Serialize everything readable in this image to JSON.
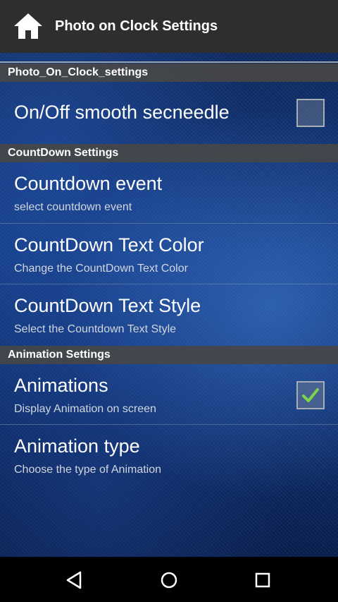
{
  "action_bar": {
    "icon": "home-icon",
    "title": "Photo on Clock Settings"
  },
  "sections": [
    {
      "header": "Photo_On_Clock_settings",
      "items": [
        {
          "title": "On/Off smooth secneedle",
          "summary": "",
          "checkbox": true,
          "checked": false
        }
      ]
    },
    {
      "header": "CountDown Settings",
      "items": [
        {
          "title": "Countdown event",
          "summary": "select countdown event"
        },
        {
          "title": "CountDown Text Color",
          "summary": "Change the CountDown Text Color"
        },
        {
          "title": "CountDown Text Style",
          "summary": "Select the Countdown Text Style"
        }
      ]
    },
    {
      "header": "Animation Settings",
      "items": [
        {
          "title": "Animations",
          "summary": "Display Animation on screen",
          "checkbox": true,
          "checked": true
        },
        {
          "title": "Animation type",
          "summary": "Choose the type of Animation"
        }
      ]
    }
  ],
  "nav_bar": {
    "back": "back-triangle-icon",
    "home": "home-circle-icon",
    "recents": "recents-square-icon"
  },
  "colors": {
    "action_bar": "#2e2e2e",
    "section_header": "#464646",
    "background_blue": "#123a82",
    "check_green": "#7dd34a"
  }
}
